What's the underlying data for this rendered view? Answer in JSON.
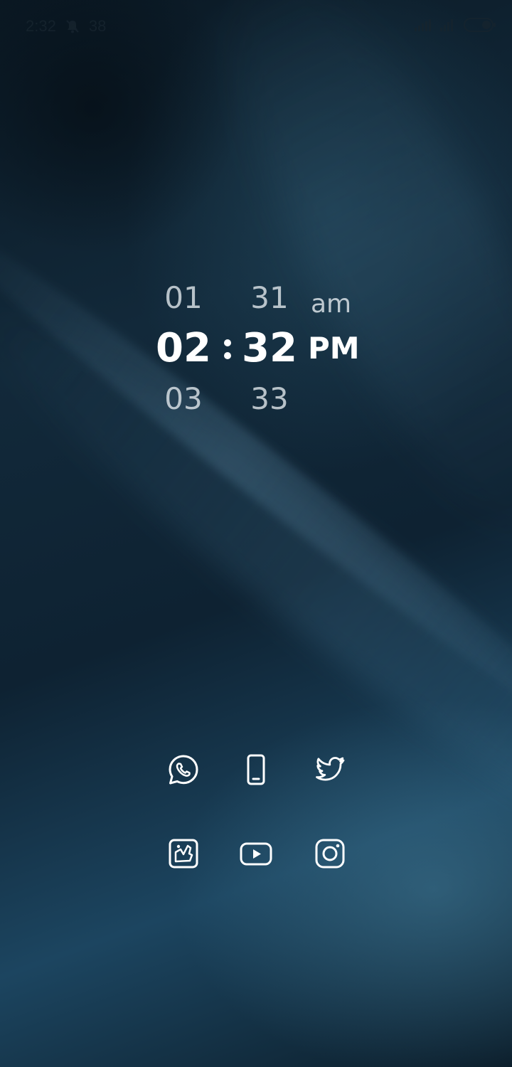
{
  "status_bar": {
    "time": "2:32",
    "notification_count": "38",
    "icons": [
      "bell-muted-icon",
      "signal-icon",
      "signal-icon-2",
      "battery-icon"
    ]
  },
  "clock": {
    "hour_above": "01",
    "hour_current": "02",
    "hour_below": "03",
    "minute_above": "31",
    "minute_current": "32",
    "minute_below": "33",
    "period_above": "am",
    "period_current": "PM",
    "separator": ":"
  },
  "apps": [
    {
      "name": "whatsapp",
      "icon": "whatsapp-icon"
    },
    {
      "name": "phone",
      "icon": "phone-icon"
    },
    {
      "name": "twitter",
      "icon": "twitter-icon"
    },
    {
      "name": "gallery",
      "icon": "gallery-icon"
    },
    {
      "name": "youtube",
      "icon": "youtube-icon"
    },
    {
      "name": "instagram",
      "icon": "instagram-icon"
    }
  ],
  "colors": {
    "text": "#ffffff",
    "background_dark": "#0b1b28",
    "background_light": "#2f6680"
  }
}
